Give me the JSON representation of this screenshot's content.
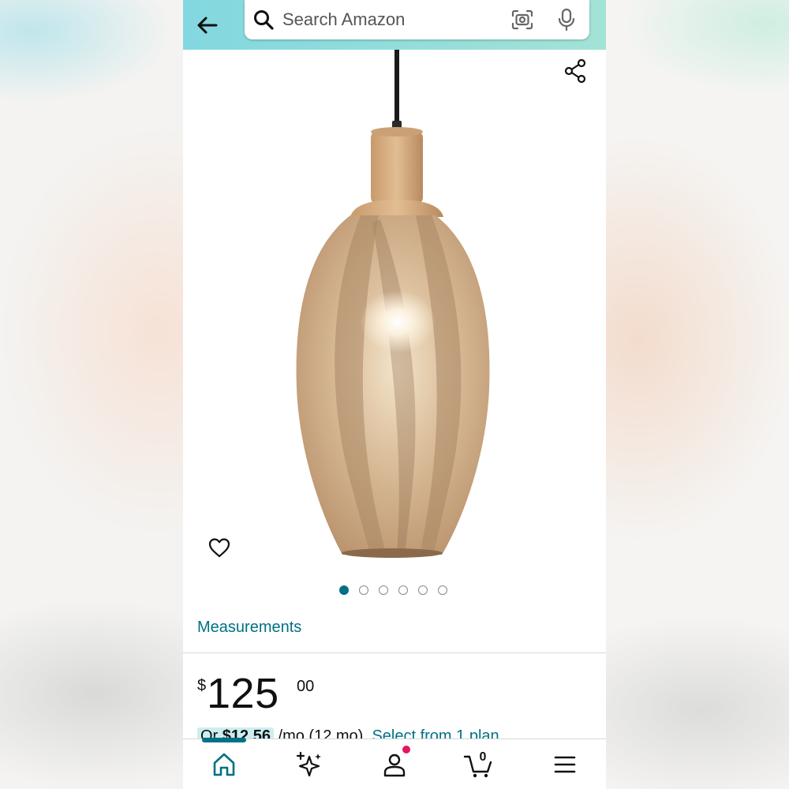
{
  "header": {
    "back_label": "Back",
    "search": {
      "placeholder": "Search Amazon",
      "value": ""
    }
  },
  "product": {
    "image_alt": "Linen pendant light with wooden neck",
    "carousel": {
      "count": 6,
      "active_index": 0
    },
    "measurements_link": "Measurements",
    "price": {
      "currency_symbol": "$",
      "whole": "125",
      "fraction": "00"
    },
    "plan": {
      "prefix": "Or ",
      "amount": "$12.56",
      "period": " /mo (12 mo). ",
      "link": "Select from 1 plan"
    }
  },
  "bottom_nav": {
    "items": [
      {
        "name": "Home",
        "icon": "home-icon"
      },
      {
        "name": "AI",
        "icon": "sparkle-icon"
      },
      {
        "name": "Account",
        "icon": "account-icon"
      },
      {
        "name": "Cart",
        "icon": "cart-icon"
      },
      {
        "name": "Menu",
        "icon": "menu-icon"
      }
    ],
    "cart_count": "0"
  },
  "colors": {
    "accent": "#007185",
    "header_gradient_start": "#83d7e0",
    "header_gradient_end": "#a3e3d6",
    "notification": "#e2175b"
  }
}
